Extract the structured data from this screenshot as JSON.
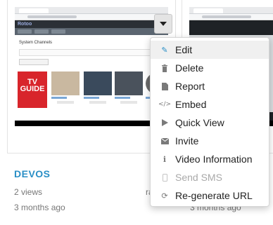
{
  "card": {
    "title": "DEVOS",
    "views": "2 views",
    "age": "3 months ago"
  },
  "thumbnail": {
    "app_logo": "Rotoo",
    "page_title": "System Channels",
    "tv_guide_line1": "TV",
    "tv_guide_line2": "GUIDE"
  },
  "behind_menu": {
    "left_fragment": "ra",
    "right_age": "3 months ago"
  },
  "menu": {
    "items": [
      {
        "label": "Edit",
        "icon": "pencil-icon",
        "state": "active"
      },
      {
        "label": "Delete",
        "icon": "trash-icon",
        "state": "normal"
      },
      {
        "label": "Report",
        "icon": "file-icon",
        "state": "normal"
      },
      {
        "label": "Embed",
        "icon": "code-icon",
        "state": "normal"
      },
      {
        "label": "Quick View",
        "icon": "play-icon",
        "state": "normal"
      },
      {
        "label": "Invite",
        "icon": "envelope-icon",
        "state": "normal"
      },
      {
        "label": "Video Information",
        "icon": "info-icon",
        "state": "normal"
      },
      {
        "label": "Send SMS",
        "icon": "mobile-icon",
        "state": "disabled"
      },
      {
        "label": "Re-generate URL",
        "icon": "refresh-icon",
        "state": "normal"
      }
    ]
  },
  "colors": {
    "accent": "#2a8fc6",
    "tv_guide_red": "#d8252b",
    "app_header": "#2b3036"
  }
}
